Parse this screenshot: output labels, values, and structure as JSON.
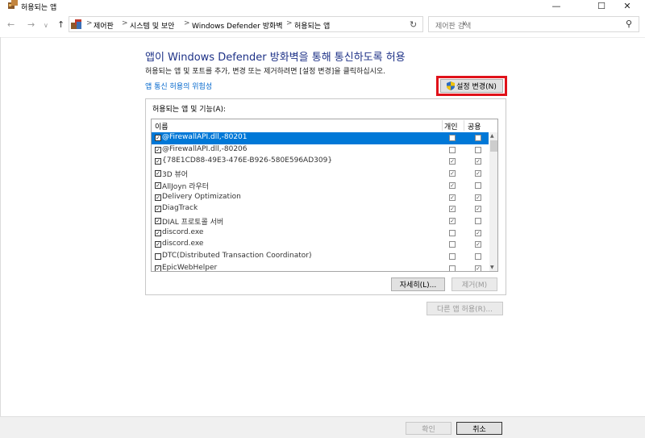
{
  "window": {
    "title": "허용되는 앱",
    "minimize_glyph": "—",
    "maximize_glyph": "☐",
    "close_glyph": "✕"
  },
  "nav": {
    "back_glyph": "←",
    "forward_glyph": "→",
    "up_glyph": "↑",
    "breadcrumb": [
      "제어판",
      "시스템 및 보안",
      "Windows Defender 방화벽",
      "허용되는 앱"
    ],
    "separator": ">",
    "dropdown_glyph": "∨",
    "refresh_glyph": "↻",
    "search_placeholder": "제어판 검색",
    "search_glyph": "⚲"
  },
  "content": {
    "heading": "앱이 Windows Defender 방화벽을 통해 통신하도록 허용",
    "description": "허용되는 앱 및 포트를 추가, 변경 또는 제거하려면 [설정 변경]을 클릭하십시오.",
    "risk_link": "앱 통신 허용의 위험성",
    "change_settings_label": "설정 변경(N)"
  },
  "panel": {
    "label": "허용되는 앱 및 기능(A):",
    "columns": {
      "name": "이름",
      "private": "개인",
      "public": "공용"
    },
    "rows": [
      {
        "name": "@FirewallAPI.dll,-80201",
        "enabled": true,
        "private": false,
        "public": false,
        "selected": true
      },
      {
        "name": "@FirewallAPI.dll,-80206",
        "enabled": true,
        "private": false,
        "public": false
      },
      {
        "name": "{78E1CD88-49E3-476E-B926-580E596AD309}",
        "enabled": true,
        "private": true,
        "public": true
      },
      {
        "name": "3D 뷰어",
        "enabled": true,
        "private": true,
        "public": true
      },
      {
        "name": "AllJoyn 라우터",
        "enabled": true,
        "private": true,
        "public": false
      },
      {
        "name": "Delivery Optimization",
        "enabled": true,
        "private": true,
        "public": true
      },
      {
        "name": "DiagTrack",
        "enabled": true,
        "private": true,
        "public": true
      },
      {
        "name": "DIAL 프로토콜 서버",
        "enabled": true,
        "private": true,
        "public": false
      },
      {
        "name": "discord.exe",
        "enabled": true,
        "private": false,
        "public": true
      },
      {
        "name": "discord.exe",
        "enabled": true,
        "private": false,
        "public": true
      },
      {
        "name": "DTC(Distributed Transaction Coordinator)",
        "enabled": false,
        "private": false,
        "public": false
      },
      {
        "name": "EpicWebHelper",
        "enabled": true,
        "private": false,
        "public": true
      }
    ],
    "details_label": "자세히(L)...",
    "remove_label": "제거(M)"
  },
  "allow_another_label": "다른 앱 허용(R)...",
  "footer": {
    "ok_label": "확인",
    "cancel_label": "취소"
  }
}
